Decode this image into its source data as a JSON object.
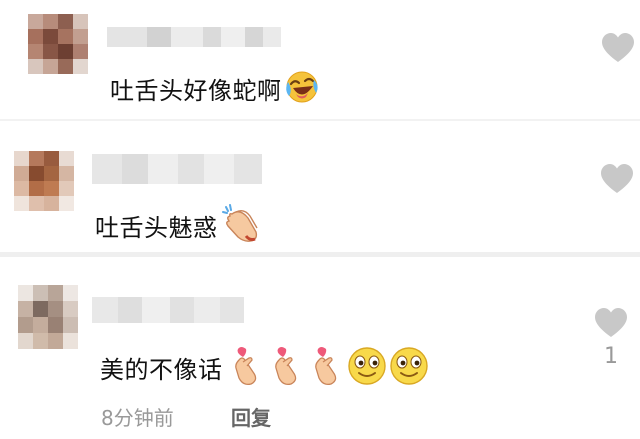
{
  "comments": [
    {
      "text": "吐舌头好像蛇啊",
      "emojis": [
        "laugh-cry-emoji"
      ]
    },
    {
      "text": "吐舌头魅惑",
      "emojis": [
        "clapping-hands-emoji"
      ]
    },
    {
      "text": "美的不像话",
      "emojis": [
        "finger-heart-emoji",
        "finger-heart-emoji",
        "finger-heart-emoji",
        "smiley-emoji",
        "smiley-emoji"
      ],
      "like_count": "1",
      "time": "8分钟前",
      "reply_label": "回复"
    }
  ],
  "colors": {
    "heart": "#c8c8c8",
    "meta": "#999999",
    "divider": "#efefef"
  }
}
